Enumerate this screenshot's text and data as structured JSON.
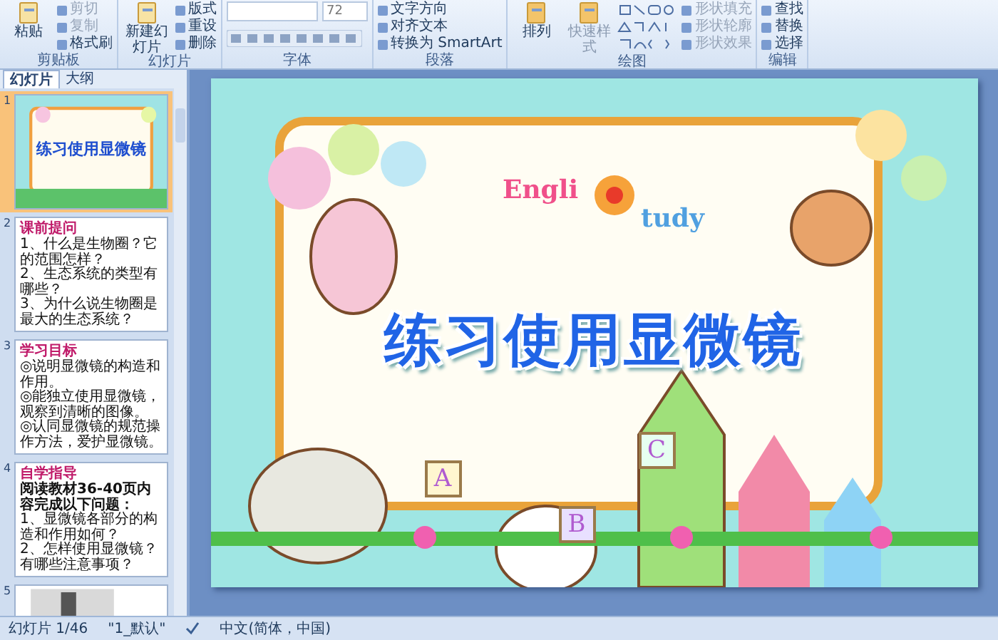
{
  "ribbon": {
    "groups": [
      {
        "kind": "clipboard",
        "label": "剪贴板",
        "big": [
          "粘贴"
        ],
        "items": [
          {
            "label": "剪切",
            "disabled": true
          },
          {
            "label": "复制",
            "disabled": true
          },
          {
            "label": "格式刷",
            "disabled": false
          }
        ]
      },
      {
        "kind": "slides",
        "label": "幻灯片",
        "big": [
          "新建幻灯片"
        ],
        "items": [
          {
            "label": "版式",
            "disabled": false
          },
          {
            "label": "重设",
            "disabled": false
          },
          {
            "label": "删除",
            "disabled": false
          }
        ]
      },
      {
        "kind": "font",
        "label": "字体",
        "font_size": "72"
      },
      {
        "kind": "paragraph",
        "label": "段落",
        "items": [
          {
            "label": "文字方向",
            "disabled": false
          },
          {
            "label": "对齐文本",
            "disabled": false
          },
          {
            "label": "转换为 SmartArt",
            "disabled": false
          }
        ]
      },
      {
        "kind": "drawing",
        "label": "绘图",
        "big": [
          "排列",
          "快速样式"
        ],
        "items": [
          {
            "label": "形状填充",
            "disabled": true
          },
          {
            "label": "形状轮廓",
            "disabled": true
          },
          {
            "label": "形状效果",
            "disabled": true
          }
        ]
      },
      {
        "kind": "editing",
        "label": "编辑",
        "items": [
          {
            "label": "查找",
            "disabled": false
          },
          {
            "label": "替换",
            "disabled": false
          },
          {
            "label": "选择",
            "disabled": false
          }
        ]
      }
    ]
  },
  "panel": {
    "tabs": [
      {
        "label": "幻灯片",
        "selected": true
      },
      {
        "label": "大纲",
        "selected": false
      }
    ],
    "slides": [
      {
        "number": "1",
        "selected": true,
        "kind": "title",
        "title": "练习使用显微镜"
      },
      {
        "number": "2",
        "selected": false,
        "kind": "list",
        "heading": "课前提问",
        "lines": [
          "1、什么是生物圈？它的范围怎样？",
          "2、生态系统的类型有哪些？",
          "3、为什么说生物圈是最大的生态系统？"
        ]
      },
      {
        "number": "3",
        "selected": false,
        "kind": "list",
        "heading": "学习目标",
        "lines": [
          "◎说明显微镜的构造和作用。",
          "◎能独立使用显微镜，观察到清晰的图像。",
          "◎认同显微镜的规范操作方法，爱护显微镜。"
        ]
      },
      {
        "number": "4",
        "selected": false,
        "kind": "list",
        "heading": "自学指导",
        "intro": "阅读教材36-40页内容完成以下问题：",
        "lines": [
          "1、显微镜各部分的构造和作用如何？",
          "2、怎样使用显微镜？有哪些注意事项？"
        ]
      },
      {
        "number": "5",
        "selected": false,
        "kind": "picture"
      }
    ]
  },
  "slide": {
    "logo_left": "Engli",
    "logo_right": "tudy",
    "title": "练习使用显微镜",
    "cards": [
      "A",
      "B",
      "C"
    ]
  },
  "status_bar": {
    "slide": "幻灯片 1/46",
    "theme": "\"1_默认\"",
    "language": "中文(简体，中国)"
  }
}
